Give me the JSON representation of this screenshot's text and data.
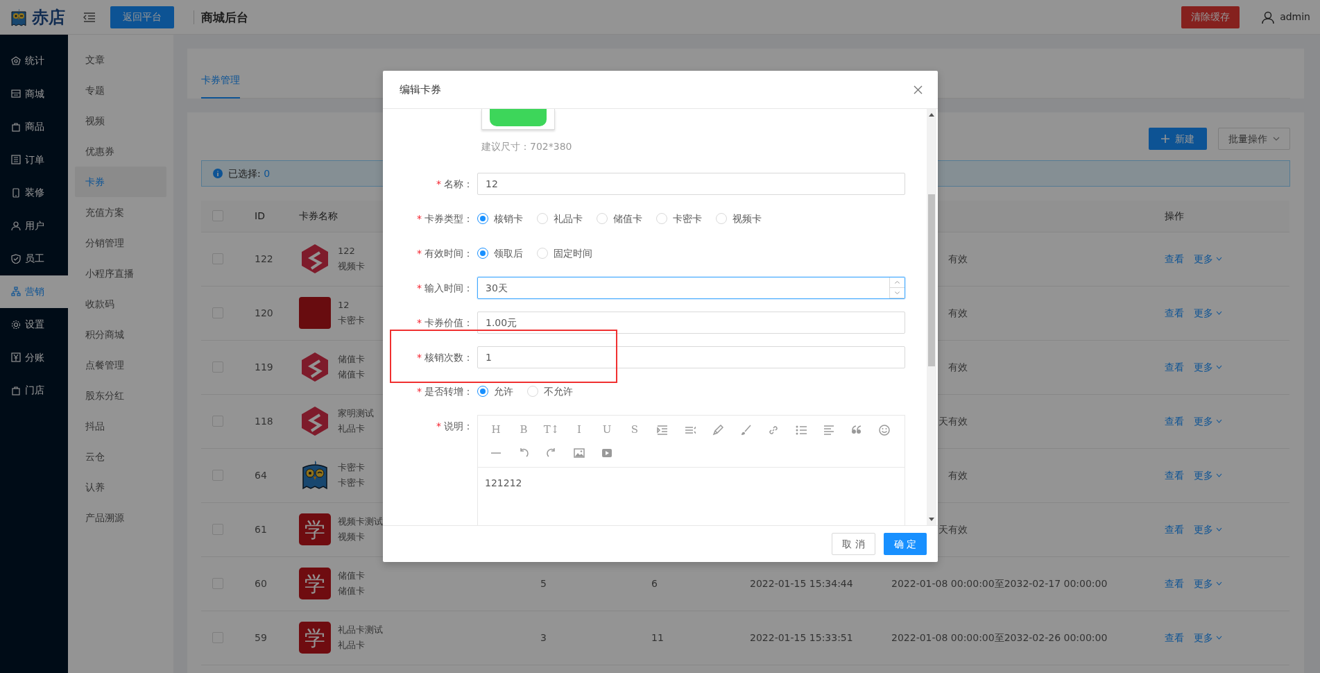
{
  "topbar": {
    "logo_text": "赤店",
    "back_button": "返回平台",
    "title": "商城后台",
    "clear_cache_button": "清除缓存",
    "user": "admin"
  },
  "main_menu": [
    {
      "label": "统计",
      "selected": false
    },
    {
      "label": "商城",
      "selected": false
    },
    {
      "label": "商品",
      "selected": false
    },
    {
      "label": "订单",
      "selected": false
    },
    {
      "label": "装修",
      "selected": false
    },
    {
      "label": "用户",
      "selected": false
    },
    {
      "label": "员工",
      "selected": false
    },
    {
      "label": "营销",
      "selected": true
    },
    {
      "label": "设置",
      "selected": false
    },
    {
      "label": "分账",
      "selected": false
    },
    {
      "label": "门店",
      "selected": false
    }
  ],
  "sub_menu": [
    {
      "label": "文章",
      "selected": false
    },
    {
      "label": "专题",
      "selected": false
    },
    {
      "label": "视频",
      "selected": false
    },
    {
      "label": "优惠券",
      "selected": false
    },
    {
      "label": "卡券",
      "selected": true
    },
    {
      "label": "充值方案",
      "selected": false
    },
    {
      "label": "分销管理",
      "selected": false
    },
    {
      "label": "小程序直播",
      "selected": false
    },
    {
      "label": "收款码",
      "selected": false
    },
    {
      "label": "积分商城",
      "selected": false
    },
    {
      "label": "点餐管理",
      "selected": false
    },
    {
      "label": "股东分红",
      "selected": false
    },
    {
      "label": "抖品",
      "selected": false
    },
    {
      "label": "云仓",
      "selected": false
    },
    {
      "label": "认养",
      "selected": false
    },
    {
      "label": "产品溯源",
      "selected": false
    }
  ],
  "tabs": [
    {
      "label": "卡券管理",
      "selected": true
    }
  ],
  "toolbar": {
    "new_button": "新建",
    "batch_button": "批量操作"
  },
  "selection_alert": {
    "label": "已选择:",
    "count": "0"
  },
  "table": {
    "select_all_checked": false,
    "columns": [
      "ID",
      "卡券名称",
      "操作"
    ],
    "rows": [
      {
        "checked": false,
        "id": "122",
        "thumb": {
          "kind": "hexagon"
        },
        "name": "122",
        "type": "视频卡",
        "column_7": "有效",
        "actions": [
          "查看",
          "更多"
        ]
      },
      {
        "checked": false,
        "id": "120",
        "thumb": {
          "kind": "photo"
        },
        "name": "12",
        "type": "卡密卡",
        "column_7": "有效",
        "actions": [
          "查看",
          "更多"
        ]
      },
      {
        "checked": false,
        "id": "119",
        "thumb": {
          "kind": "hexagon"
        },
        "name": "储值卡",
        "type": "储值卡",
        "column_7": "有效",
        "actions": [
          "查看",
          "更多"
        ]
      },
      {
        "checked": false,
        "id": "118",
        "thumb": {
          "kind": "hexagon"
        },
        "name": "家明测试",
        "type": "礼品卡",
        "column_7": "天有效",
        "actions": [
          "查看",
          "更多"
        ]
      },
      {
        "checked": false,
        "id": "64",
        "thumb": {
          "kind": "owl"
        },
        "name": "卡密卡",
        "type": "卡密卡",
        "column_7": "有效",
        "actions": [
          "查看",
          "更多"
        ]
      },
      {
        "checked": false,
        "id": "61",
        "thumb": {
          "kind": "glyph",
          "label": "学"
        },
        "name": "视频卡测试",
        "type": "视频卡",
        "column_7": "天有效",
        "actions": [
          "查看",
          "更多"
        ]
      },
      {
        "checked": false,
        "id": "60",
        "thumb": {
          "kind": "glyph",
          "label": "学"
        },
        "name": "储值卡",
        "type": "储值卡",
        "column_4": "5",
        "column_5": "6",
        "column_6": "2022-01-15 15:34:44",
        "column_7": "2022-01-08 00:00:00至2032-02-17 00:00:00",
        "actions": [
          "查看",
          "更多"
        ]
      },
      {
        "checked": false,
        "id": "59",
        "thumb": {
          "kind": "glyph",
          "label": "学"
        },
        "name": "礼品卡测试",
        "type": "礼品卡",
        "column_4": "3",
        "column_5": "11",
        "column_6": "2022-01-15 15:33:51",
        "column_7": "2022-01-08 00:00:00至2032-02-26 00:00:00",
        "actions": [
          "查看",
          "更多"
        ]
      }
    ]
  },
  "modal": {
    "title": "编辑卡券",
    "image_hint": "建议尺寸：702*380",
    "fields": [
      {
        "kind": "text",
        "mark": "*",
        "label": "名称：",
        "value": "12"
      },
      {
        "kind": "radio",
        "mark": "*",
        "label": "卡券类型：",
        "options": [
          {
            "label": "核销卡",
            "selected": true
          },
          {
            "label": "礼品卡",
            "selected": false
          },
          {
            "label": "储值卡",
            "selected": false
          },
          {
            "label": "卡密卡",
            "selected": false
          },
          {
            "label": "视频卡",
            "selected": false
          }
        ]
      },
      {
        "kind": "radio",
        "mark": "*",
        "label": "有效时间：",
        "options": [
          {
            "label": "领取后",
            "selected": true
          },
          {
            "label": "固定时间",
            "selected": false
          }
        ]
      },
      {
        "kind": "number",
        "mark": "*",
        "label": "输入时间：",
        "value": "30天",
        "focused": true
      },
      {
        "kind": "text",
        "mark": "*",
        "label": "卡券价值：",
        "value": "1.00元"
      },
      {
        "kind": "text",
        "mark": "*",
        "label": "核销次数：",
        "value": "1",
        "highlighted": true
      },
      {
        "kind": "radio",
        "mark": "*",
        "label": "是否转增：",
        "options": [
          {
            "label": "允许",
            "selected": true
          },
          {
            "label": "不允许",
            "selected": false
          }
        ]
      },
      {
        "kind": "editor",
        "mark": "*",
        "label": "说明：",
        "value": "121212",
        "toolbar": [
          {
            "kind": "glyph",
            "label": "H"
          },
          {
            "kind": "glyph",
            "label": "B"
          },
          {
            "kind": "glyph",
            "label": "T↕"
          },
          {
            "kind": "glyph",
            "label": "I"
          },
          {
            "kind": "glyph",
            "label": "U"
          },
          {
            "kind": "glyph",
            "label": "S"
          },
          {
            "kind": "indent"
          },
          {
            "kind": "lineheight"
          },
          {
            "kind": "pen"
          },
          {
            "kind": "brush"
          },
          {
            "kind": "link"
          },
          {
            "kind": "list"
          },
          {
            "kind": "align"
          },
          {
            "kind": "quote"
          },
          {
            "kind": "smile"
          },
          {
            "kind": "rule"
          },
          {
            "kind": "undo"
          },
          {
            "kind": "redo"
          },
          {
            "kind": "image"
          },
          {
            "kind": "video"
          }
        ]
      }
    ],
    "cancel_button": "取 消",
    "ok_button": "确 定"
  }
}
